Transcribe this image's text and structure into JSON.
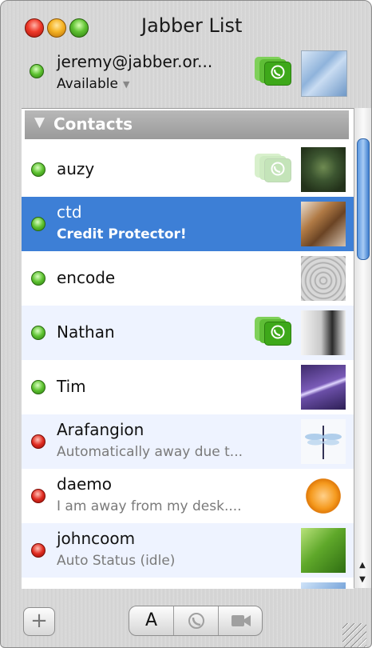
{
  "window": {
    "title": "Jabber List"
  },
  "account": {
    "name": "jeremy@jabber.or...",
    "status": "Available",
    "status_color": "#5cc12f",
    "icons": [
      "green-status-dot",
      "phone-icon",
      "avatar"
    ]
  },
  "group": {
    "label": "Contacts",
    "expanded": true
  },
  "contacts": [
    {
      "name": "auzy",
      "status_text": "",
      "status": "available",
      "phone": "faded"
    },
    {
      "name": "ctd",
      "status_text": "Credit Protector!",
      "status": "available",
      "phone": "none",
      "selected": true
    },
    {
      "name": "encode",
      "status_text": "",
      "status": "available",
      "phone": "none"
    },
    {
      "name": "Nathan",
      "status_text": "",
      "status": "available",
      "phone": "active"
    },
    {
      "name": "Tim",
      "status_text": "",
      "status": "available",
      "phone": "none"
    },
    {
      "name": "Arafangion",
      "status_text": "Automatically away due t...",
      "status": "away",
      "phone": "none"
    },
    {
      "name": "daemo",
      "status_text": "I am away from my desk....",
      "status": "away",
      "phone": "none"
    },
    {
      "name": "johncoom",
      "status_text": "Auto Status (idle)",
      "status": "away",
      "phone": "none"
    }
  ],
  "toolbar": {
    "add_label": "+",
    "text_label": "A",
    "icons": [
      "plus-icon",
      "text-chat-icon",
      "phone-icon",
      "video-camera-icon"
    ]
  },
  "colors": {
    "selection": "#3d7fd6",
    "alt_row": "#eef3ff",
    "available": "#5cc12f",
    "away": "#e02b20"
  }
}
